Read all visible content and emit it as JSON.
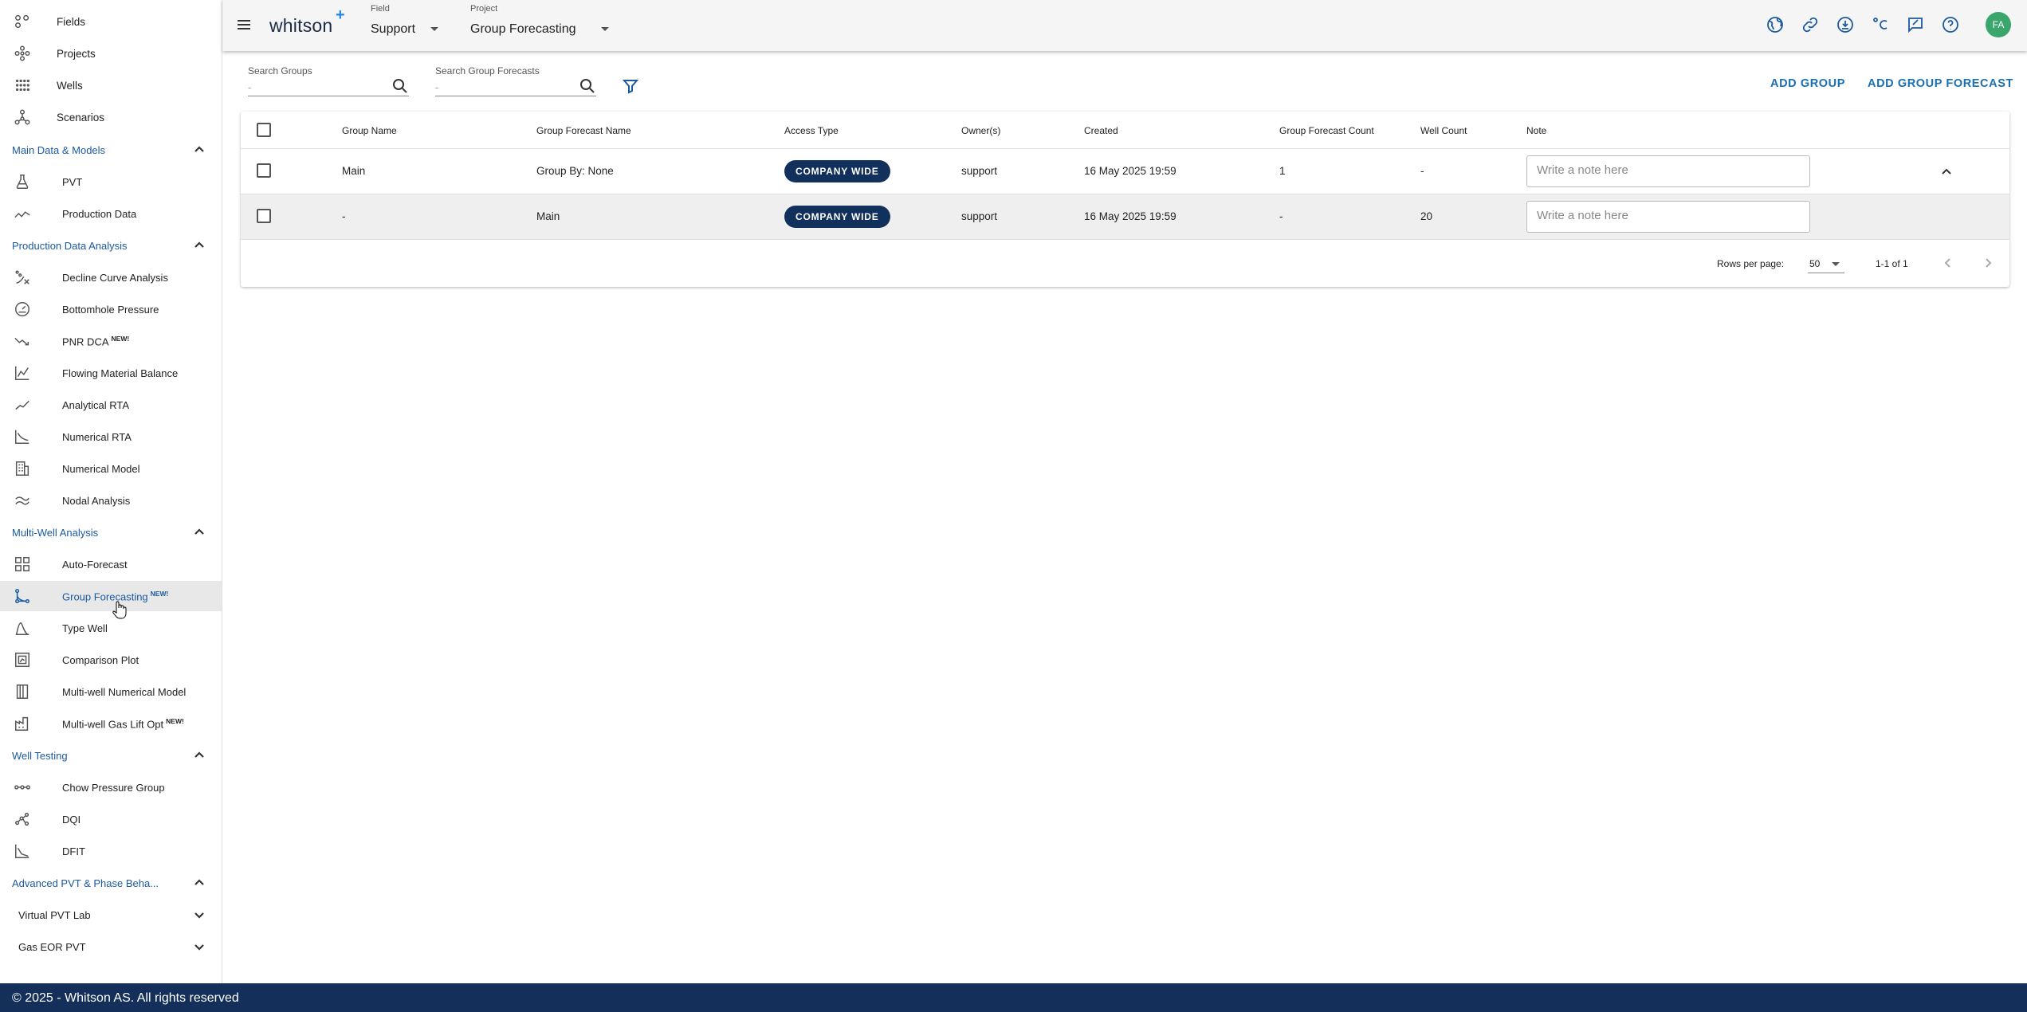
{
  "sidebar": {
    "top_items": [
      {
        "label": "Fields",
        "icon": "fields-icon"
      },
      {
        "label": "Projects",
        "icon": "projects-icon"
      },
      {
        "label": "Wells",
        "icon": "wells-icon"
      },
      {
        "label": "Scenarios",
        "icon": "scenarios-icon"
      }
    ],
    "sections": {
      "main_data": {
        "label": "Main Data & Models",
        "items": [
          "PVT",
          "Production Data"
        ]
      },
      "production_analysis": {
        "label": "Production Data Analysis",
        "items": [
          "Decline Curve Analysis",
          "Bottomhole Pressure",
          "PNR DCA",
          "Flowing Material Balance",
          "Analytical RTA",
          "Numerical RTA",
          "Numerical Model",
          "Nodal Analysis"
        ]
      },
      "multi_well": {
        "label": "Multi-Well Analysis",
        "items": [
          "Auto-Forecast",
          "Group Forecasting",
          "Type Well",
          "Comparison Plot",
          "Multi-well Numerical Model",
          "Multi-well Gas Lift Opt"
        ]
      },
      "well_testing": {
        "label": "Well Testing",
        "items": [
          "Chow Pressure Group",
          "DQI",
          "DFIT"
        ]
      },
      "advanced_pvt": {
        "label": "Advanced PVT & Phase Beha...",
        "items": [
          "Virtual PVT Lab",
          "Gas EOR PVT"
        ]
      }
    },
    "new_badge": "NEW!",
    "active_item": "Group Forecasting"
  },
  "topbar": {
    "logo": "whitson",
    "logo_plus": "+",
    "field_caption": "Field",
    "field_value": "Support",
    "project_caption": "Project",
    "project_value": "Group Forecasting",
    "avatar_initials": "FA",
    "icons": [
      "globe-icon",
      "link-icon",
      "download-icon",
      "celsius-icon",
      "feedback-icon",
      "help-icon"
    ]
  },
  "toolbar": {
    "search_groups_caption": "Search Groups",
    "search_groups_placeholder": "-",
    "search_forecasts_caption": "Search Group Forecasts",
    "search_forecasts_placeholder": "-",
    "add_group": "ADD GROUP",
    "add_group_forecast": "ADD GROUP FORECAST"
  },
  "table": {
    "columns": [
      "Group Name",
      "Group Forecast Name",
      "Access Type",
      "Owner(s)",
      "Created",
      "Group Forecast Count",
      "Well Count",
      "Note"
    ],
    "rows": [
      {
        "group_name": "Main",
        "forecast_name": "Group By: None",
        "access": "COMPANY WIDE",
        "owner": "support",
        "created": "16 May 2025 19:59",
        "forecast_count": "1",
        "well_count": "-",
        "note_placeholder": "Write a note here"
      },
      {
        "group_name": "-",
        "forecast_name": "Main",
        "access": "COMPANY WIDE",
        "owner": "support",
        "created": "16 May 2025 19:59",
        "forecast_count": "-",
        "well_count": "20",
        "note_placeholder": "Write a note here"
      }
    ],
    "rows_per_page_label": "Rows per page:",
    "rows_per_page": "50",
    "page_range": "1-1 of 1"
  },
  "footer": {
    "copyright": "© 2025 - Whitson AS. All rights reserved"
  },
  "colors": {
    "accent": "#1a5aa0",
    "badge": "#12305c",
    "statusbar": "#14305a",
    "avatar": "#3aa66b"
  }
}
